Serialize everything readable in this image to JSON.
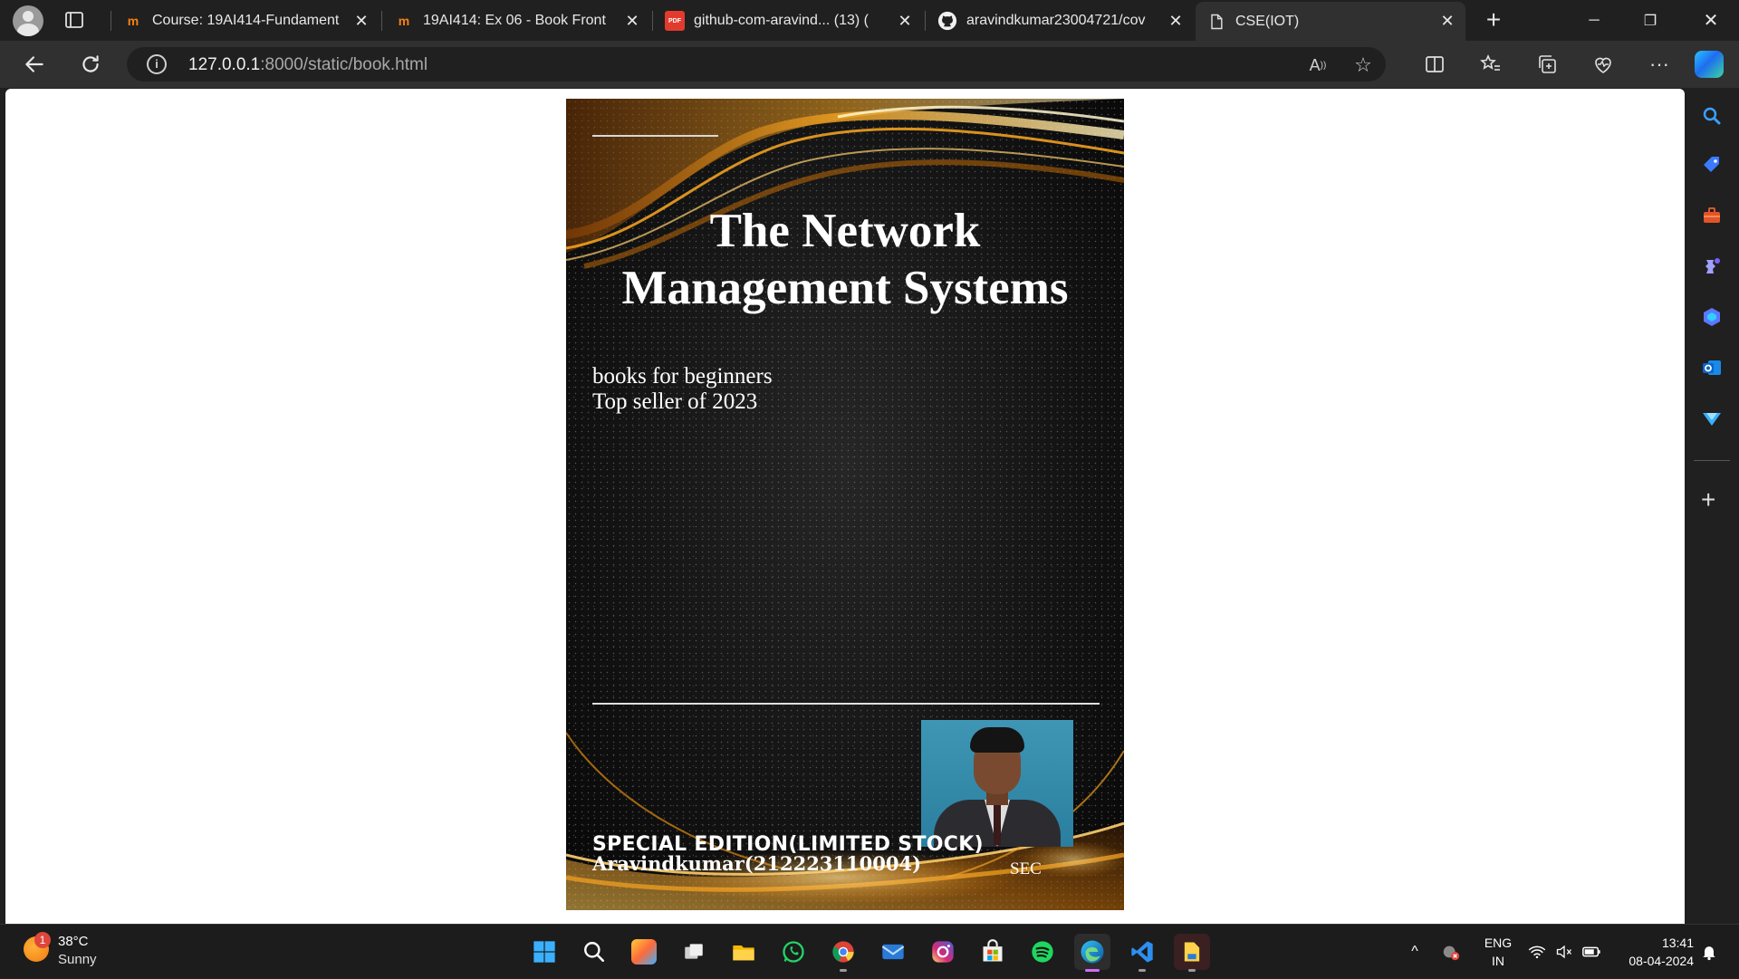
{
  "browser": {
    "tabs": [
      {
        "title": "Course: 19AI414-Fundament",
        "favicon": "moodle-icon",
        "favicon_text": "m",
        "active": false
      },
      {
        "title": "19AI414: Ex 06 - Book Front",
        "favicon": "moodle-icon",
        "favicon_text": "m",
        "active": false
      },
      {
        "title": "github-com-aravind... (13) (",
        "favicon": "pdf-icon",
        "favicon_text": "PDF",
        "active": false
      },
      {
        "title": "aravindkumar23004721/cov",
        "favicon": "github-icon",
        "favicon_text": "",
        "active": false
      },
      {
        "title": "CSE(IOT)",
        "favicon": "document-icon",
        "favicon_text": "",
        "active": true
      }
    ],
    "address": {
      "host": "127.0.0.1",
      "path": ":8000/static/book.html"
    }
  },
  "book": {
    "title_line1": "The Network",
    "title_line2": "Management Systems",
    "subtitle_line1": "books for beginners",
    "subtitle_line2": "Top seller of 2023",
    "edition": "SPECIAL EDITION(LIMITED STOCK)",
    "author": "Aravindkumar(212223110004)",
    "college": "SEC"
  },
  "taskbar": {
    "weather": {
      "temp": "38°C",
      "condition": "Sunny",
      "badge": "1"
    },
    "language": {
      "line1": "ENG",
      "line2": "IN"
    },
    "clock": {
      "time": "13:41",
      "date": "08-04-2024"
    },
    "apps": [
      "start",
      "search",
      "copilot-pre",
      "task-view",
      "file-explorer",
      "whatsapp",
      "chrome",
      "mail",
      "instagram",
      "store",
      "spotify",
      "edge",
      "vscode",
      "file-manager"
    ]
  },
  "colors": {
    "accent": "#d06cff",
    "cover_gold": "#f0a020",
    "page_bg": "#ffffff"
  }
}
